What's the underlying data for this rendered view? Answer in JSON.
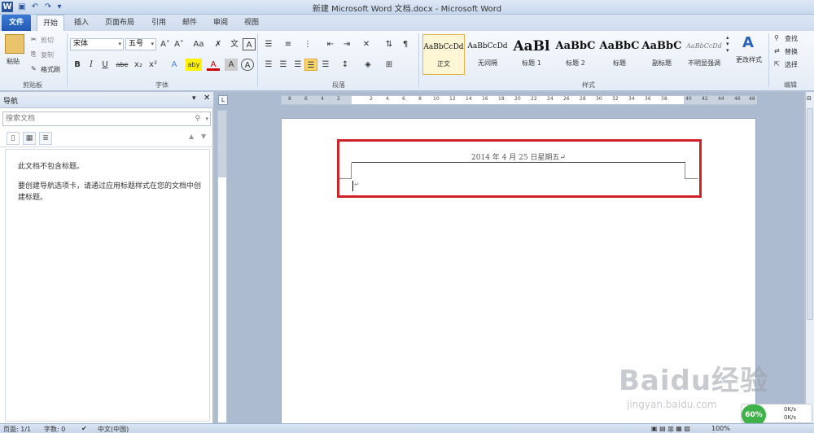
{
  "window": {
    "title": "新建 Microsoft Word 文档.docx - Microsoft Word"
  },
  "qat": {
    "icons": [
      "word-icon",
      "save-icon",
      "undo-icon",
      "redo-icon",
      "customize-icon"
    ]
  },
  "tabs": [
    "文件",
    "开始",
    "插入",
    "页面布局",
    "引用",
    "邮件",
    "审阅",
    "视图"
  ],
  "ribbon": {
    "clipboard": {
      "paste": "粘贴",
      "cut": "剪切",
      "copy": "复制",
      "format_painter": "格式刷",
      "label": "剪贴板"
    },
    "font": {
      "name": "宋体",
      "size": "五号",
      "label": "字体",
      "buttons": [
        "B",
        "I",
        "U",
        "abe",
        "x₂",
        "x²",
        "A",
        "aby",
        "A",
        "A",
        "A"
      ],
      "grow": "A˄",
      "shrink": "A˅",
      "case": "Aa"
    },
    "paragraph": {
      "label": "段落"
    },
    "styles": {
      "label": "样式",
      "items": [
        {
          "sample": "AaBbCcDd",
          "name": "正文"
        },
        {
          "sample": "AaBbCcDd",
          "name": "无间隔"
        },
        {
          "sample": "AaBl",
          "name": "标题 1"
        },
        {
          "sample": "AaBbC",
          "name": "标题 2"
        },
        {
          "sample": "AaBbC",
          "name": "标题"
        },
        {
          "sample": "AaBbC",
          "name": "副标题"
        },
        {
          "sample": "AaBbCcDd",
          "name": "不明显强调"
        }
      ],
      "change": "更改样式"
    },
    "editing": {
      "find": "查找",
      "replace": "替换",
      "select": "选择",
      "label": "编辑"
    }
  },
  "nav": {
    "title": "导航",
    "search_placeholder": "搜索文档",
    "msg1": "此文档不包含标题。",
    "msg2": "要创建导航选项卡，请通过应用标题样式在您的文档中创建标题。"
  },
  "ruler": {
    "marks": [
      "8",
      "6",
      "4",
      "2",
      "2",
      "4",
      "6",
      "8",
      "10",
      "12",
      "14",
      "16",
      "18",
      "20",
      "22",
      "24",
      "26",
      "28",
      "30",
      "32",
      "34",
      "36",
      "38",
      "40",
      "42",
      "44",
      "46",
      "48"
    ]
  },
  "document": {
    "header_text": "2014 年 4 月 25 日星期五↵",
    "paragraph_mark": "↵"
  },
  "status": {
    "page": "页面: 1/1",
    "words": "字数: 0",
    "lang": "中文(中国)",
    "zoom": "100%"
  },
  "watermark": {
    "brand": "Baidu经验",
    "url": "jingyan.baidu.com"
  },
  "net_widget": {
    "percent": "60%",
    "up": "0K/s",
    "down": "0K/s"
  }
}
